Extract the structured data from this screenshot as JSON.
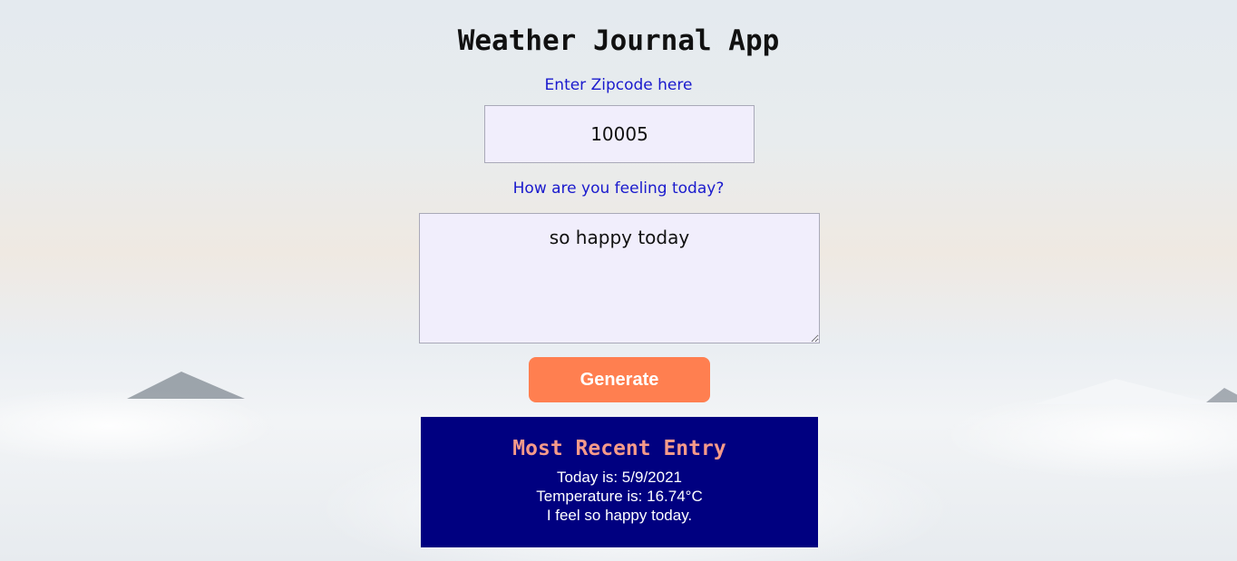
{
  "app": {
    "title": "Weather Journal App"
  },
  "zip": {
    "label": "Enter Zipcode here",
    "value": "10005"
  },
  "feelings": {
    "label": "How are you feeling today?",
    "value": "so happy today"
  },
  "actions": {
    "generate_label": "Generate"
  },
  "entry": {
    "heading": "Most Recent Entry",
    "date": "Today is: 5/9/2021",
    "temperature": "Temperature is: 16.74°C",
    "content": "I feel so happy today."
  },
  "colors": {
    "button": "#ff7f50",
    "panel": "#000080",
    "panel_heading": "#f59a8a",
    "label": "#1a1acd",
    "input_bg": "#f1eefc"
  }
}
